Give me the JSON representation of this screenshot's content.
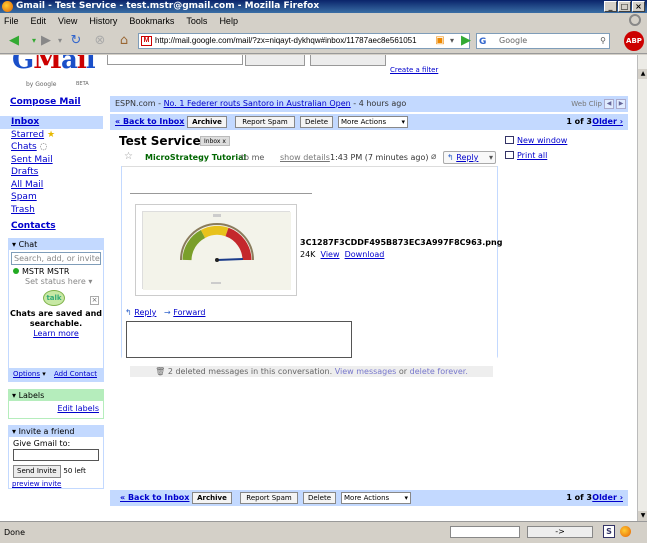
{
  "window": {
    "title": "Gmail - Test Service - test.mstr@gmail.com - Mozilla Firefox"
  },
  "menu": [
    "File",
    "Edit",
    "View",
    "History",
    "Bookmarks",
    "Tools",
    "Help"
  ],
  "browser": {
    "url": "http://mail.google.com/mail/?zx=niqayt-dykhqw#inbox/11787aec8e561051",
    "search_placeholder": "Google",
    "status": "Done"
  },
  "gmail": {
    "logo_by": "by Google",
    "logo_beta": "BETA",
    "create_filter": "Create a filter",
    "compose": "Compose Mail",
    "nav": [
      "Inbox",
      "Starred",
      "Chats",
      "Sent Mail",
      "Drafts",
      "All Mail",
      "Spam",
      "Trash"
    ],
    "contacts": "Contacts",
    "chat": {
      "header": "Chat",
      "search_placeholder": "Search, add, or invite",
      "user": "MSTR MSTR",
      "status": "Set status here",
      "saved": "Chats are saved and searchable.",
      "learn_more": "Learn more",
      "options": "Options",
      "add_contact": "Add Contact"
    },
    "labels": {
      "header": "Labels",
      "edit": "Edit labels"
    },
    "invite": {
      "header": "Invite a friend",
      "give": "Give Gmail to:",
      "button": "Send Invite",
      "left": "50 left",
      "preview": "preview invite"
    },
    "webclip": {
      "source": "ESPN.com",
      "headline": "No. 1 Federer routs Santoro in Australian Open",
      "age": "- 4 hours ago",
      "tag": "Web Clip"
    },
    "toolbar": {
      "back": "« Back to Inbox",
      "archive": "Archive",
      "report_spam": "Report Spam",
      "delete": "Delete",
      "more_actions": "More Actions",
      "count": "1 of 3",
      "older": "Older ›"
    },
    "thread": {
      "subject": "Test Service",
      "label": "Inbox",
      "new_window": "New window",
      "print_all": "Print all"
    },
    "message": {
      "sender": "MicroStrategy Tutorial",
      "to": "to me",
      "show_details": "show details",
      "time": "1:43 PM (7 minutes ago)",
      "reply": "Reply",
      "attachment_name": "3C1287F3CDDF495B873EC3A997F8C963.png",
      "attachment_size": "24K",
      "view": "View",
      "download": "Download",
      "reply_link": "Reply",
      "forward_link": "Forward"
    },
    "deleted": {
      "text": "2 deleted messages in this conversation.",
      "view": "View messages",
      "or": "or",
      "delete_forever": "delete forever."
    }
  },
  "colors": {
    "accent": "#c3d9ff",
    "link": "#0000cc",
    "sender": "#006600"
  }
}
